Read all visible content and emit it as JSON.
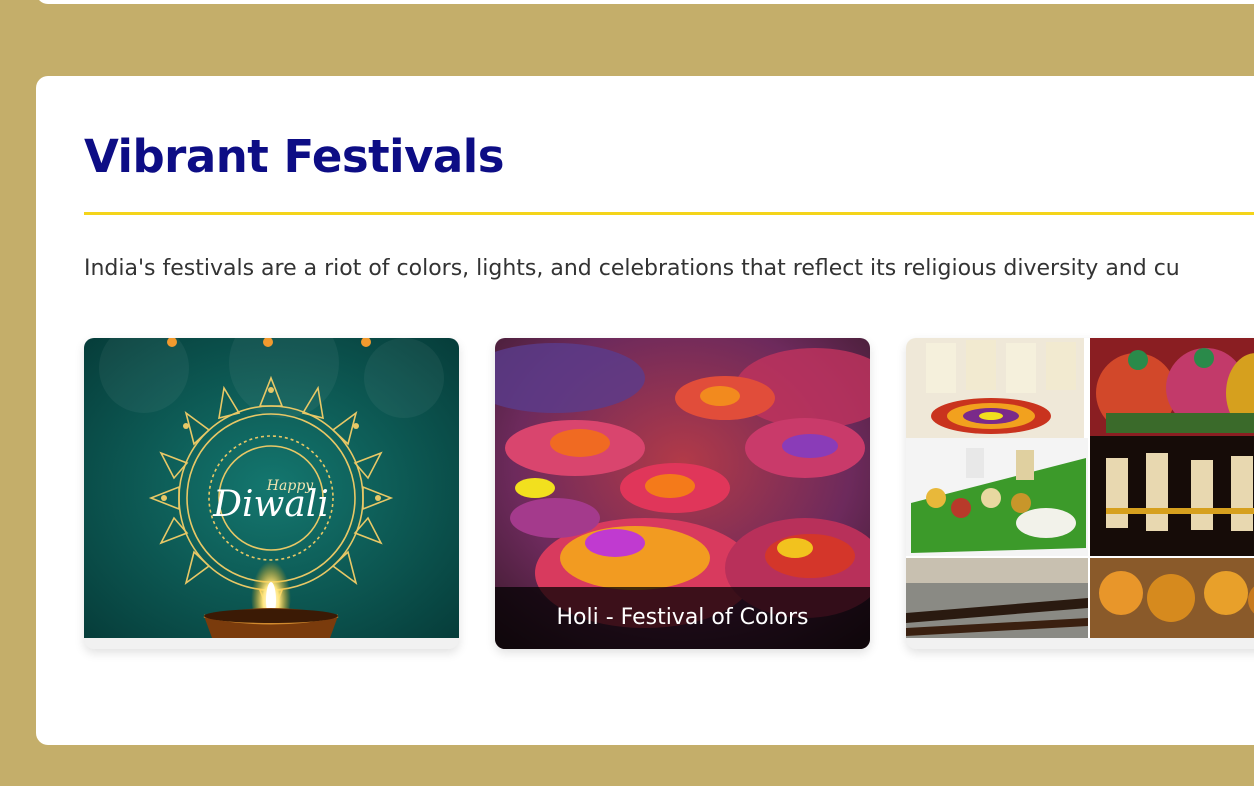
{
  "section": {
    "title": "Vibrant Festivals",
    "description": "India's festivals are a riot of colors, lights, and celebrations that reflect its religious diversity and cu"
  },
  "cards": [
    {
      "image_text_small": "Happy",
      "image_text_large": "Diwali",
      "caption": ""
    },
    {
      "caption": "Holi - Festival of Colors"
    },
    {
      "caption": ""
    }
  ],
  "colors": {
    "page_background": "#c4ae6a",
    "title": "#0d0d85",
    "accent_rule": "#f4d41a",
    "body_text": "#333333",
    "diwali_teal": "#0e5c57",
    "caption_overlay": "#000000b8"
  }
}
